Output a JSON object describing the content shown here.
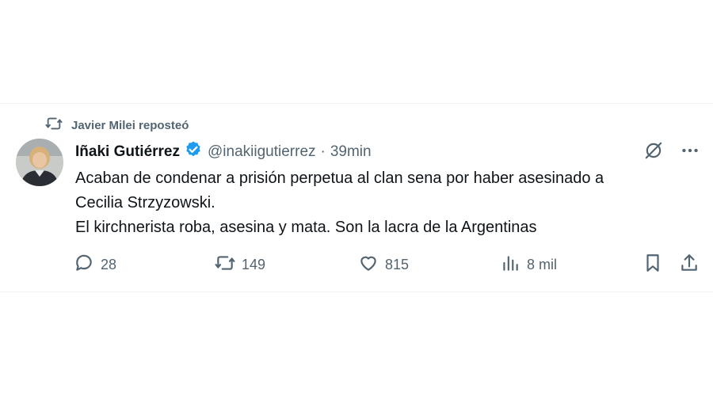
{
  "repost": {
    "text": "Javier Milei reposteó"
  },
  "author": {
    "name": "Iñaki Gutiérrez",
    "handle": "@inakiigutierrez",
    "separator": "·",
    "time": "39min"
  },
  "tweet": {
    "lines": [
      "Acaban de condenar a prisión perpetua al clan sena por haber asesinado a",
      "Cecilia Strzyzowski.",
      "El kirchnerista roba, asesina y mata. Son la lacra de la Argentinas"
    ]
  },
  "metrics": {
    "replies": "28",
    "reposts": "149",
    "likes": "815",
    "views": "8 mil"
  },
  "icons": [
    "repost-icon",
    "verified-icon",
    "grok-icon",
    "more-icon",
    "reply-icon",
    "like-icon",
    "views-icon",
    "bookmark-icon",
    "share-icon"
  ],
  "colors": {
    "verified": "#1d9bf0",
    "muted": "#536471",
    "text": "#0f1419"
  }
}
